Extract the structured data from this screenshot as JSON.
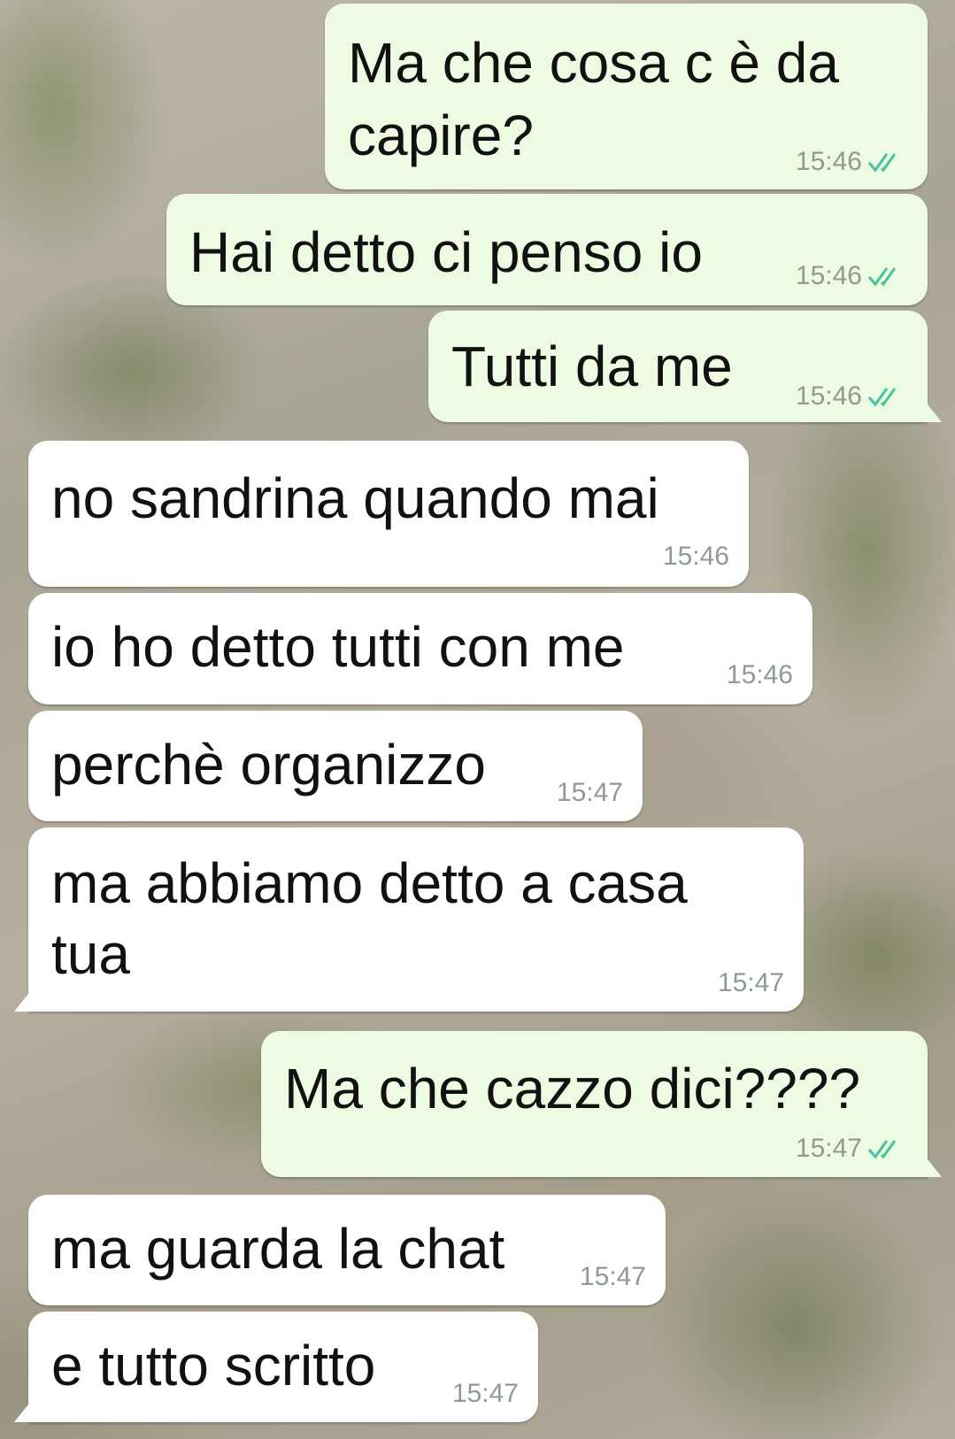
{
  "messages": [
    {
      "dir": "out",
      "text_line1": "Ma che cosa c è da",
      "text_line2": "capire?",
      "time": "15:46",
      "status": "read"
    },
    {
      "dir": "out",
      "text": "Hai detto ci penso io",
      "time": "15:46",
      "status": "read"
    },
    {
      "dir": "out",
      "text": "Tutti da me",
      "time": "15:46",
      "status": "read"
    },
    {
      "dir": "in",
      "text": "no sandrina quando mai",
      "time": "15:46"
    },
    {
      "dir": "in",
      "text": "io ho detto tutti con me",
      "time": "15:46"
    },
    {
      "dir": "in",
      "text": "perchè organizzo",
      "time": "15:47"
    },
    {
      "dir": "in",
      "text_line1": "ma abbiamo detto a casa",
      "text_line2": "tua",
      "time": "15:47"
    },
    {
      "dir": "out",
      "text": "Ma che cazzo dici????",
      "time": "15:47",
      "status": "read"
    },
    {
      "dir": "in",
      "text": "ma guarda la chat",
      "time": "15:47"
    },
    {
      "dir": "in",
      "text": "e tutto scritto",
      "time": "15:47"
    }
  ],
  "icons": {
    "read_receipt": "double-check-icon"
  },
  "colors": {
    "outgoing_bubble": "#eefbe3",
    "incoming_bubble": "#ffffff",
    "tick_read": "#4fc3a1",
    "time": "#8f9a93"
  }
}
